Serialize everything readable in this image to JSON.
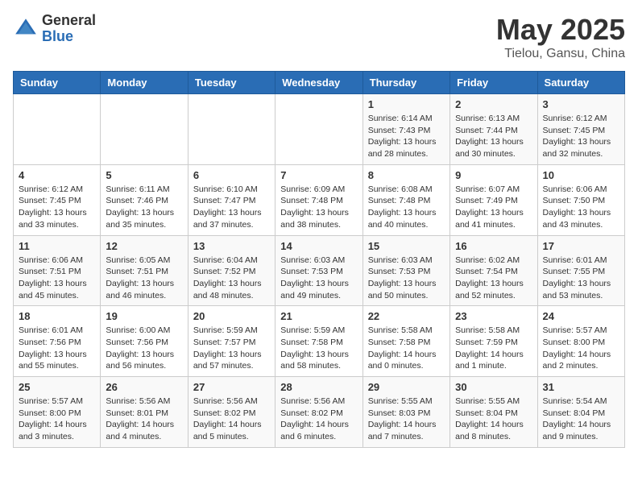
{
  "logo": {
    "general": "General",
    "blue": "Blue"
  },
  "header": {
    "title": "May 2025",
    "subtitle": "Tielou, Gansu, China"
  },
  "weekdays": [
    "Sunday",
    "Monday",
    "Tuesday",
    "Wednesday",
    "Thursday",
    "Friday",
    "Saturday"
  ],
  "weeks": [
    [
      {
        "day": "",
        "info": ""
      },
      {
        "day": "",
        "info": ""
      },
      {
        "day": "",
        "info": ""
      },
      {
        "day": "",
        "info": ""
      },
      {
        "day": "1",
        "info": "Sunrise: 6:14 AM\nSunset: 7:43 PM\nDaylight: 13 hours\nand 28 minutes."
      },
      {
        "day": "2",
        "info": "Sunrise: 6:13 AM\nSunset: 7:44 PM\nDaylight: 13 hours\nand 30 minutes."
      },
      {
        "day": "3",
        "info": "Sunrise: 6:12 AM\nSunset: 7:45 PM\nDaylight: 13 hours\nand 32 minutes."
      }
    ],
    [
      {
        "day": "4",
        "info": "Sunrise: 6:12 AM\nSunset: 7:45 PM\nDaylight: 13 hours\nand 33 minutes."
      },
      {
        "day": "5",
        "info": "Sunrise: 6:11 AM\nSunset: 7:46 PM\nDaylight: 13 hours\nand 35 minutes."
      },
      {
        "day": "6",
        "info": "Sunrise: 6:10 AM\nSunset: 7:47 PM\nDaylight: 13 hours\nand 37 minutes."
      },
      {
        "day": "7",
        "info": "Sunrise: 6:09 AM\nSunset: 7:48 PM\nDaylight: 13 hours\nand 38 minutes."
      },
      {
        "day": "8",
        "info": "Sunrise: 6:08 AM\nSunset: 7:48 PM\nDaylight: 13 hours\nand 40 minutes."
      },
      {
        "day": "9",
        "info": "Sunrise: 6:07 AM\nSunset: 7:49 PM\nDaylight: 13 hours\nand 41 minutes."
      },
      {
        "day": "10",
        "info": "Sunrise: 6:06 AM\nSunset: 7:50 PM\nDaylight: 13 hours\nand 43 minutes."
      }
    ],
    [
      {
        "day": "11",
        "info": "Sunrise: 6:06 AM\nSunset: 7:51 PM\nDaylight: 13 hours\nand 45 minutes."
      },
      {
        "day": "12",
        "info": "Sunrise: 6:05 AM\nSunset: 7:51 PM\nDaylight: 13 hours\nand 46 minutes."
      },
      {
        "day": "13",
        "info": "Sunrise: 6:04 AM\nSunset: 7:52 PM\nDaylight: 13 hours\nand 48 minutes."
      },
      {
        "day": "14",
        "info": "Sunrise: 6:03 AM\nSunset: 7:53 PM\nDaylight: 13 hours\nand 49 minutes."
      },
      {
        "day": "15",
        "info": "Sunrise: 6:03 AM\nSunset: 7:53 PM\nDaylight: 13 hours\nand 50 minutes."
      },
      {
        "day": "16",
        "info": "Sunrise: 6:02 AM\nSunset: 7:54 PM\nDaylight: 13 hours\nand 52 minutes."
      },
      {
        "day": "17",
        "info": "Sunrise: 6:01 AM\nSunset: 7:55 PM\nDaylight: 13 hours\nand 53 minutes."
      }
    ],
    [
      {
        "day": "18",
        "info": "Sunrise: 6:01 AM\nSunset: 7:56 PM\nDaylight: 13 hours\nand 55 minutes."
      },
      {
        "day": "19",
        "info": "Sunrise: 6:00 AM\nSunset: 7:56 PM\nDaylight: 13 hours\nand 56 minutes."
      },
      {
        "day": "20",
        "info": "Sunrise: 5:59 AM\nSunset: 7:57 PM\nDaylight: 13 hours\nand 57 minutes."
      },
      {
        "day": "21",
        "info": "Sunrise: 5:59 AM\nSunset: 7:58 PM\nDaylight: 13 hours\nand 58 minutes."
      },
      {
        "day": "22",
        "info": "Sunrise: 5:58 AM\nSunset: 7:58 PM\nDaylight: 14 hours\nand 0 minutes."
      },
      {
        "day": "23",
        "info": "Sunrise: 5:58 AM\nSunset: 7:59 PM\nDaylight: 14 hours\nand 1 minute."
      },
      {
        "day": "24",
        "info": "Sunrise: 5:57 AM\nSunset: 8:00 PM\nDaylight: 14 hours\nand 2 minutes."
      }
    ],
    [
      {
        "day": "25",
        "info": "Sunrise: 5:57 AM\nSunset: 8:00 PM\nDaylight: 14 hours\nand 3 minutes."
      },
      {
        "day": "26",
        "info": "Sunrise: 5:56 AM\nSunset: 8:01 PM\nDaylight: 14 hours\nand 4 minutes."
      },
      {
        "day": "27",
        "info": "Sunrise: 5:56 AM\nSunset: 8:02 PM\nDaylight: 14 hours\nand 5 minutes."
      },
      {
        "day": "28",
        "info": "Sunrise: 5:56 AM\nSunset: 8:02 PM\nDaylight: 14 hours\nand 6 minutes."
      },
      {
        "day": "29",
        "info": "Sunrise: 5:55 AM\nSunset: 8:03 PM\nDaylight: 14 hours\nand 7 minutes."
      },
      {
        "day": "30",
        "info": "Sunrise: 5:55 AM\nSunset: 8:04 PM\nDaylight: 14 hours\nand 8 minutes."
      },
      {
        "day": "31",
        "info": "Sunrise: 5:54 AM\nSunset: 8:04 PM\nDaylight: 14 hours\nand 9 minutes."
      }
    ]
  ]
}
